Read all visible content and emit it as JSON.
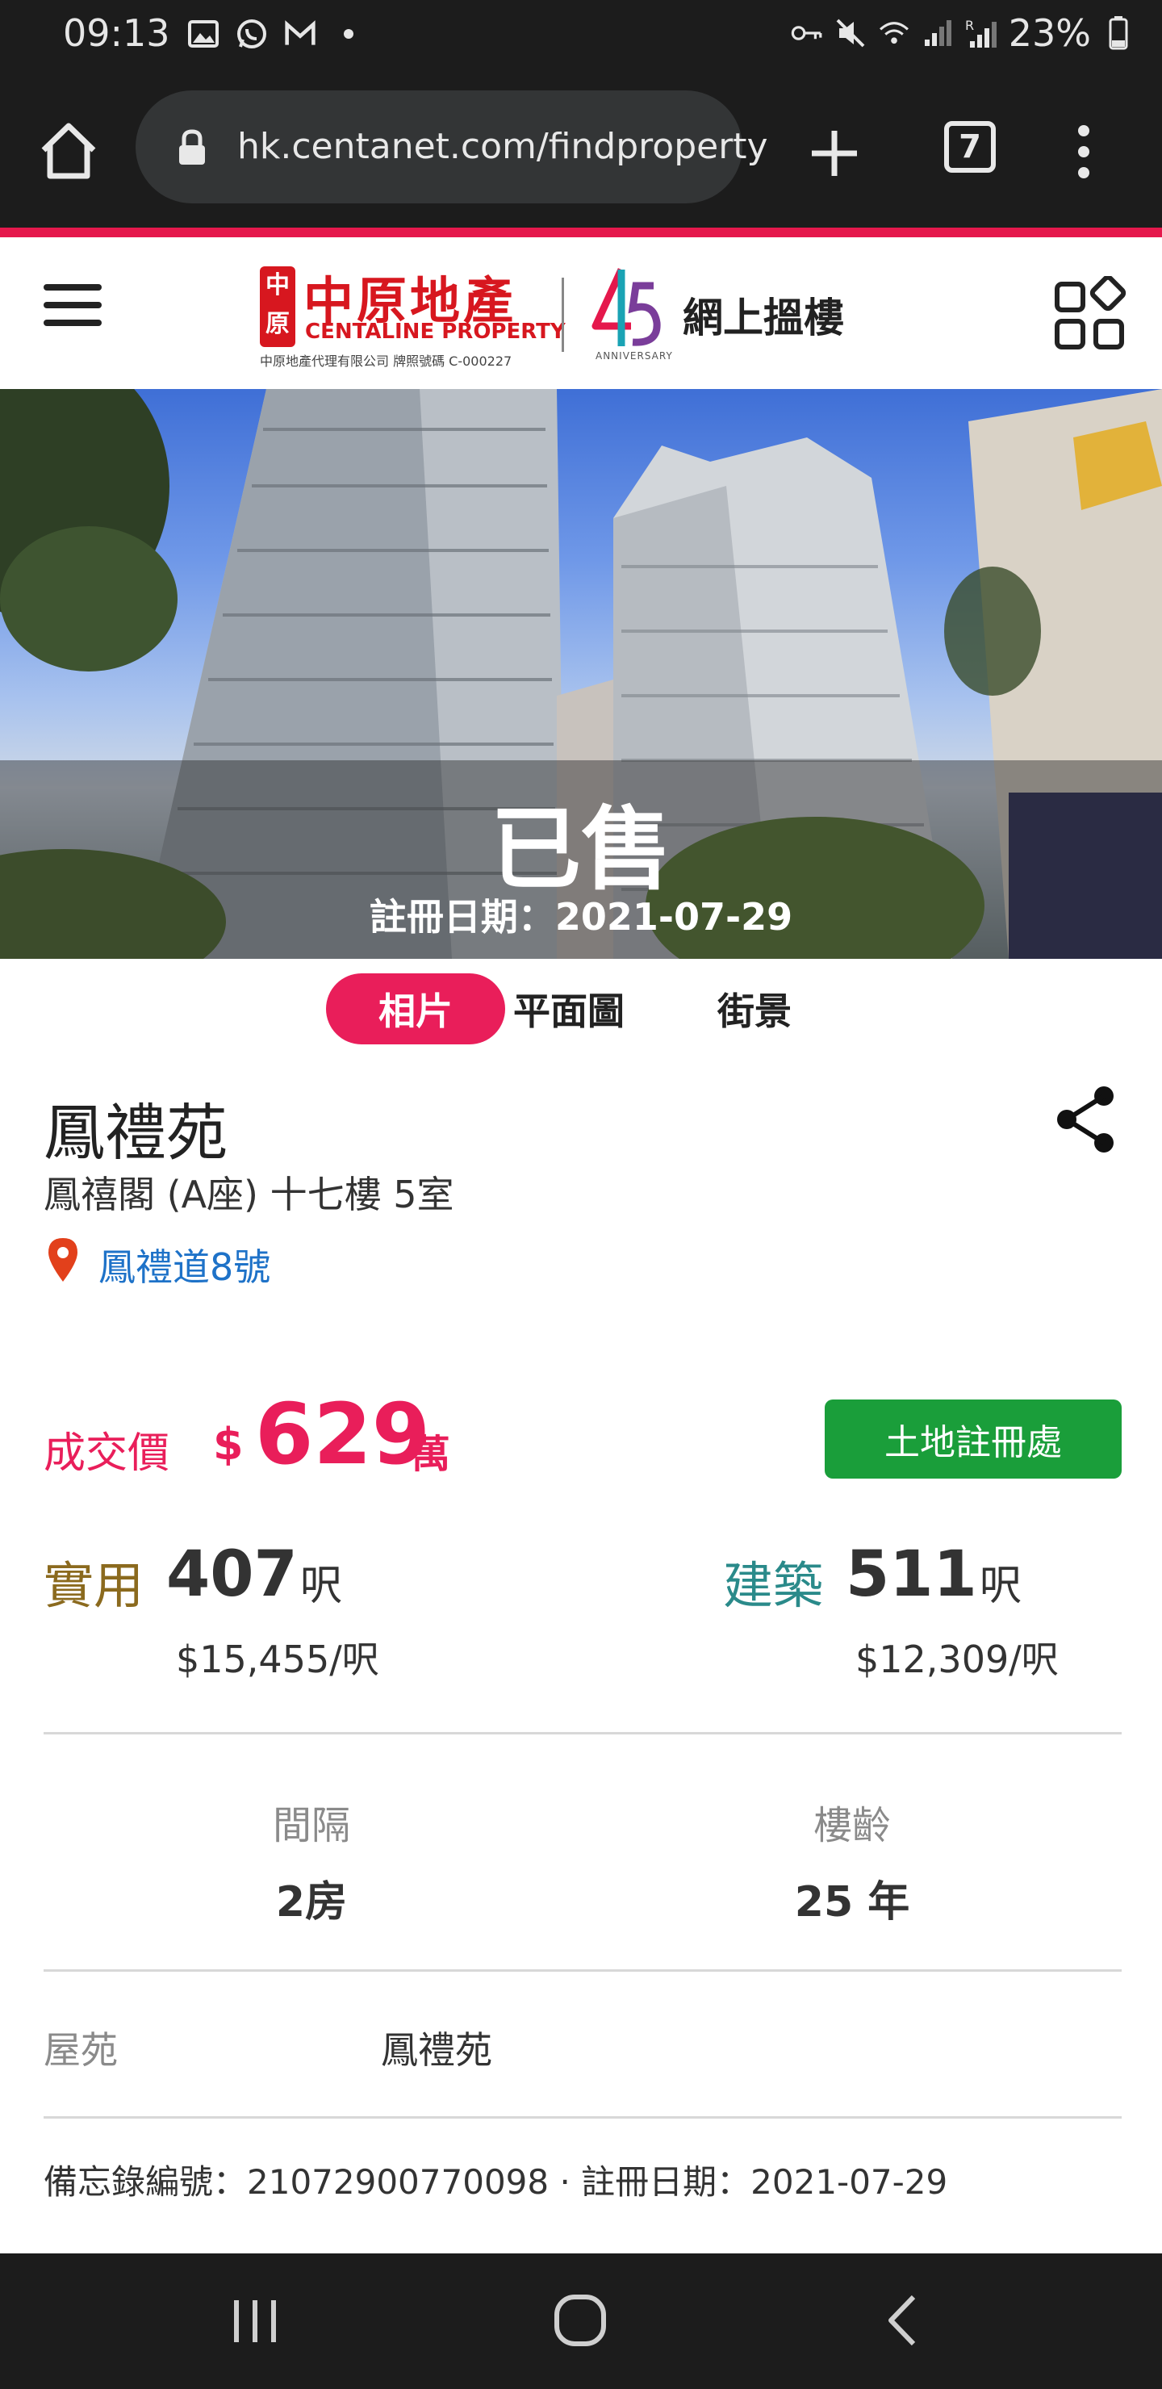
{
  "status_bar": {
    "time": "09:13",
    "battery_text": "23%",
    "icons_left": [
      "gallery-icon",
      "whatsapp-icon",
      "gmail-icon",
      "dot-icon"
    ],
    "icons_right": [
      "vpn-key-icon",
      "mute-icon",
      "wifi-icon",
      "signal-icon",
      "signal-r-icon",
      "battery-icon"
    ]
  },
  "browser": {
    "url": "hk.centanet.com/findproperty",
    "tab_count": "7"
  },
  "site_header": {
    "logo_cn": "中原地產",
    "logo_en": "CENTALINE PROPERTY",
    "logo_sub": "中原地產代理有限公司  牌照號碼 C-000227",
    "logo_mark_text": "中原",
    "anniversary_label": "ANNIVERSARY",
    "title": "網上搵樓"
  },
  "hero": {
    "status": "已售",
    "reg_date_text": "註冊日期：2021-07-29"
  },
  "media_tabs": [
    {
      "label": "相片",
      "active": true
    },
    {
      "label": "平面圖",
      "active": false
    },
    {
      "label": "街景",
      "active": false
    }
  ],
  "property": {
    "name": "鳳禮苑",
    "address": "鳳禧閣 (A座) 十七樓 5室",
    "street": "鳳禮道8號"
  },
  "price": {
    "label": "成交價",
    "currency": "$",
    "value": "629",
    "unit": "萬",
    "land_registry_button": "土地註冊處"
  },
  "areas": {
    "saleable": {
      "label": "實用",
      "value": "407",
      "unit": "呎",
      "price_per_ft": "$15,455/呎"
    },
    "gross": {
      "label": "建築",
      "value": "511",
      "unit": "呎",
      "price_per_ft": "$12,309/呎"
    }
  },
  "specs": {
    "layout_label": "間隔",
    "layout_value": "2房",
    "age_label": "樓齡",
    "age_value": "25 年"
  },
  "estate": {
    "label": "屋苑",
    "value": "鳳禮苑"
  },
  "memo": "備忘錄編號：21072900770098 · 註冊日期：2021-07-29",
  "colors": {
    "accent_pink": "#e91e5a",
    "brand_red": "#d7171f",
    "green_button": "#1a9e3a",
    "saleable_gold": "#8b6a1e",
    "gross_teal": "#2a8a8a",
    "link_blue": "#1e72c8"
  }
}
